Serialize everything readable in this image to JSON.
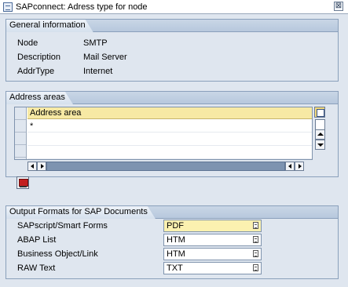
{
  "window": {
    "title": "SAPconnect: Adress type for node",
    "close_glyph": "⊠"
  },
  "general": {
    "header": "General information",
    "fields": [
      {
        "label": "Node",
        "value": "SMTP"
      },
      {
        "label": "Description",
        "value": "Mail Server"
      },
      {
        "label": "AddrType",
        "value": "Internet"
      }
    ]
  },
  "address_areas": {
    "header": "Address areas",
    "column_header": "Address area",
    "rows": [
      "*",
      "",
      ""
    ]
  },
  "output_formats": {
    "header": "Output Formats for SAP Documents",
    "rows": [
      {
        "label": "SAPscript/Smart Forms",
        "value": "PDF"
      },
      {
        "label": "ABAP List",
        "value": "HTM"
      },
      {
        "label": "Business Object/Link",
        "value": "HTM"
      },
      {
        "label": "RAW Text",
        "value": "TXT"
      }
    ]
  },
  "icons": {
    "app": "sap-window-icon",
    "close": "close-icon",
    "table_settings": "table-settings-icon",
    "export": "export-icon",
    "f4_help": "value-help-icon"
  },
  "colors": {
    "background": "#dfe6ef",
    "column_header": "#f7e9a4",
    "active_field": "#fbf1b0",
    "group_border": "#8aa0bb"
  }
}
